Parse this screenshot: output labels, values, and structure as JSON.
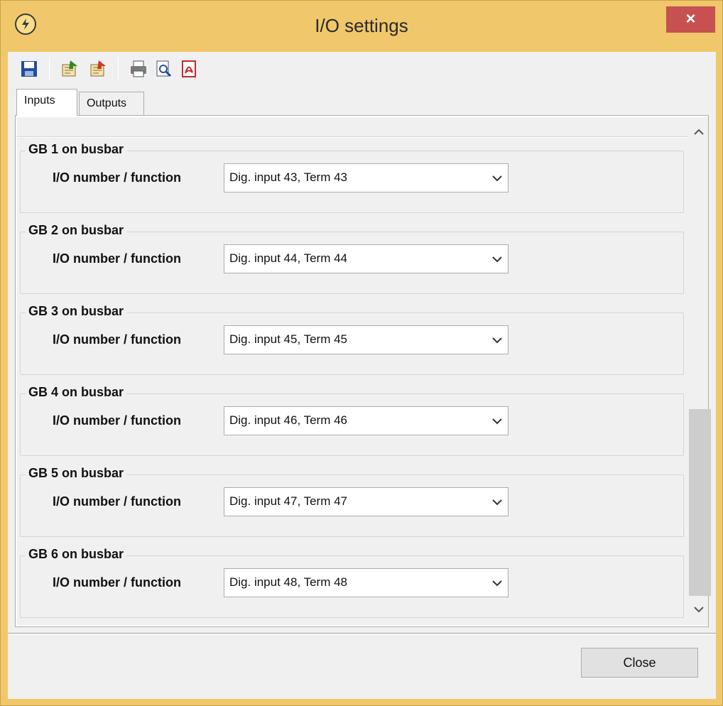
{
  "window": {
    "title": "I/O settings",
    "close_glyph": "×"
  },
  "toolbar": {
    "items": [
      {
        "icon": "save-icon"
      },
      {
        "icon": "read-from-device-icon"
      },
      {
        "icon": "write-to-device-icon"
      },
      {
        "icon": "print-icon"
      },
      {
        "icon": "print-preview-icon"
      },
      {
        "icon": "export-pdf-icon"
      }
    ]
  },
  "tabs": [
    {
      "label": "Inputs",
      "active": true
    },
    {
      "label": "Outputs",
      "active": false
    }
  ],
  "groups": [
    {
      "title": "GB 1 on busbar",
      "field_label": "I/O number / function",
      "value": "Dig. input 43, Term  43"
    },
    {
      "title": "GB 2 on busbar",
      "field_label": "I/O number / function",
      "value": "Dig. input 44, Term  44"
    },
    {
      "title": "GB 3 on busbar",
      "field_label": "I/O number / function",
      "value": "Dig. input 45, Term  45"
    },
    {
      "title": "GB 4 on busbar",
      "field_label": "I/O number / function",
      "value": "Dig. input 46, Term  46"
    },
    {
      "title": "GB 5 on busbar",
      "field_label": "I/O number / function",
      "value": "Dig. input 47, Term  47"
    },
    {
      "title": "GB 6 on busbar",
      "field_label": "I/O number / function",
      "value": "Dig. input 48, Term  48"
    }
  ],
  "footer": {
    "close_label": "Close"
  },
  "colors": {
    "frame": "#f0c76a",
    "close_button_bg": "#c75050",
    "client_bg": "#f0f0f0"
  }
}
